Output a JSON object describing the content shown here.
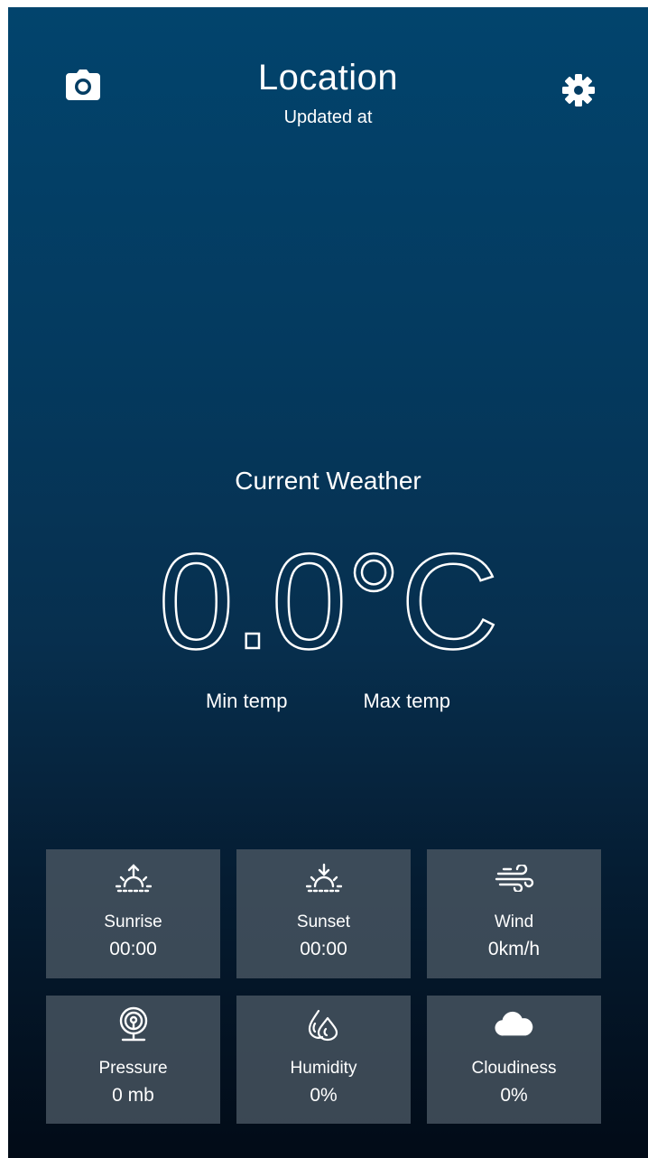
{
  "header": {
    "title": "Location",
    "subtitle": "Updated at"
  },
  "icons": {
    "camera": "camera-icon",
    "settings": "gear-icon"
  },
  "current": {
    "label": "Current Weather",
    "temperature": "0.0°C",
    "min_label": "Min temp",
    "max_label": "Max temp"
  },
  "tiles": [
    {
      "icon": "sunrise-icon",
      "label": "Sunrise",
      "value": "00:00"
    },
    {
      "icon": "sunset-icon",
      "label": "Sunset",
      "value": "00:00"
    },
    {
      "icon": "wind-icon",
      "label": "Wind",
      "value": "0km/h"
    },
    {
      "icon": "pressure-icon",
      "label": "Pressure",
      "value": "0 mb"
    },
    {
      "icon": "humidity-icon",
      "label": "Humidity",
      "value": "0%"
    },
    {
      "icon": "cloud-icon",
      "label": "Cloudiness",
      "value": "0%"
    }
  ],
  "colors": {
    "background_top": "#02446d",
    "background_bottom": "#020b17",
    "tile_background": "#4b5864",
    "text": "#ffffff"
  }
}
